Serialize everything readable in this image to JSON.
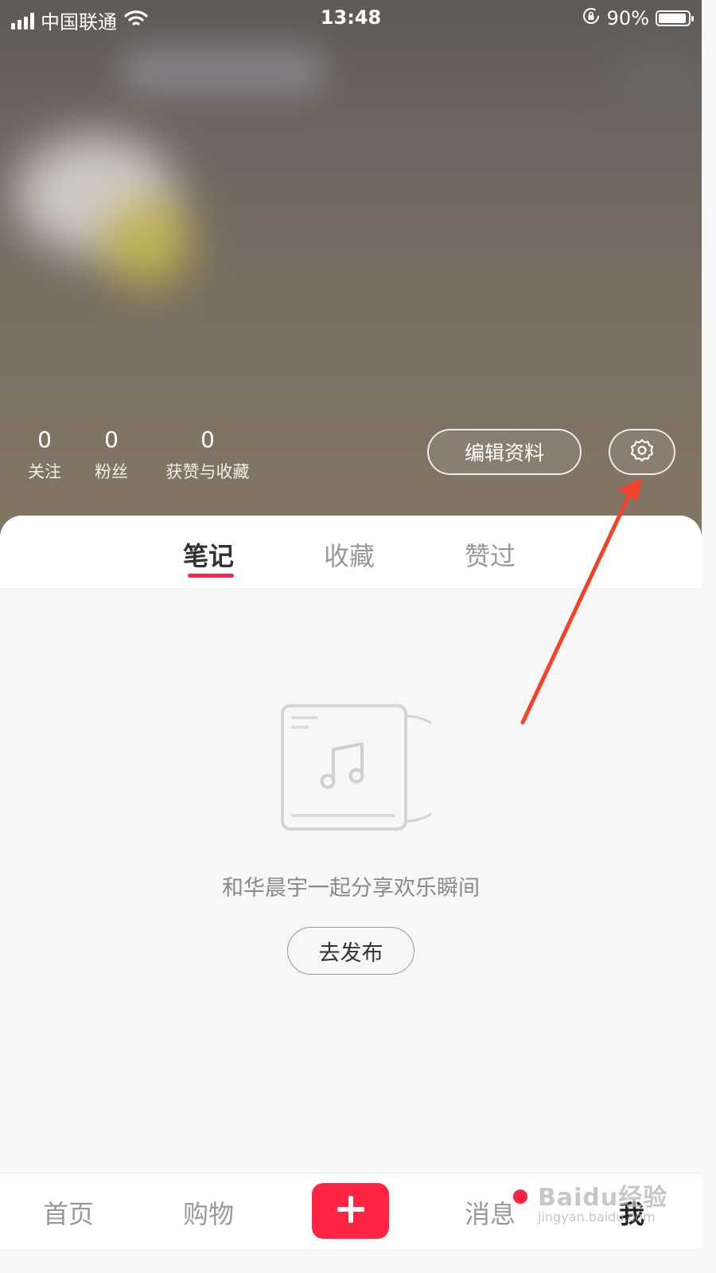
{
  "status_bar": {
    "carrier": "中国联通",
    "time": "13:48",
    "battery": "90%"
  },
  "profile": {
    "stats": [
      {
        "value": "0",
        "label": "关注"
      },
      {
        "value": "0",
        "label": "粉丝"
      },
      {
        "value": "0",
        "label": "获赞与收藏"
      }
    ],
    "edit_button_label": "编辑资料"
  },
  "tabs": [
    {
      "label": "笔记",
      "active": true
    },
    {
      "label": "收藏",
      "active": false
    },
    {
      "label": "赞过",
      "active": false
    }
  ],
  "empty_state": {
    "message": "和华晨宇一起分享欢乐瞬间",
    "publish_button_label": "去发布",
    "icon": "music-album-icon"
  },
  "bottom_nav": [
    {
      "label": "首页",
      "active": false
    },
    {
      "label": "购物",
      "active": false
    },
    {
      "label": "消息",
      "active": false,
      "has_badge": true
    },
    {
      "label": "我",
      "active": true
    }
  ],
  "watermark": {
    "brand": "Baidu经验",
    "sub": "jingyan.baidu.com"
  },
  "colors": {
    "accent": "#ff2442",
    "annotation_arrow": "#f2432a"
  }
}
